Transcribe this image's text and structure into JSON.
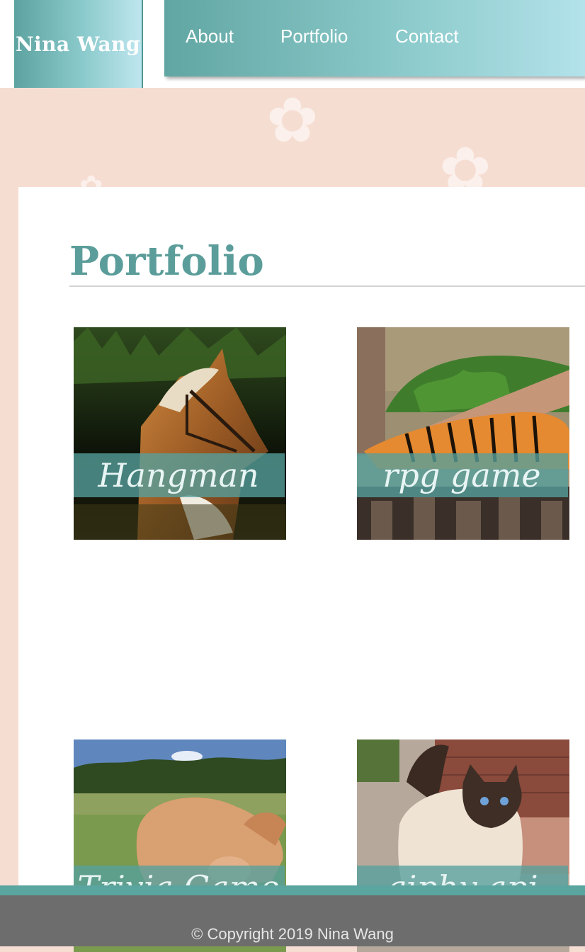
{
  "header": {
    "brand": "Nina Wang",
    "nav": [
      {
        "label": "About"
      },
      {
        "label": "Portfolio"
      },
      {
        "label": "Contact"
      }
    ]
  },
  "main": {
    "title": "Portfolio",
    "projects": [
      {
        "label": "Hangman",
        "image": "horse-photo"
      },
      {
        "label": "rpg game",
        "image": "tiger-photo"
      },
      {
        "label": "Trivia Game",
        "image": "pig-photo"
      },
      {
        "label": "giphy api",
        "image": "cat-photo"
      }
    ]
  },
  "footer": {
    "copyright": "© Copyright 2019 Nina Wang"
  },
  "colors": {
    "accent": "#5b9d9a",
    "background": "#f6ddd2",
    "footer": "#6d6d6d"
  }
}
